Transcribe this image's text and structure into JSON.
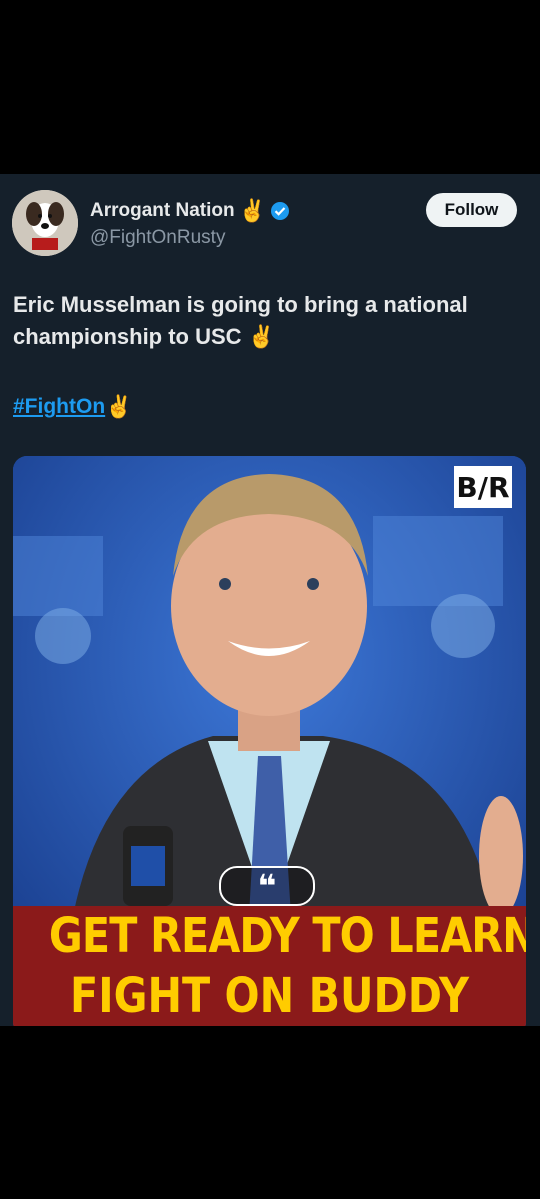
{
  "tweet": {
    "author_name": "Arrogant Nation",
    "author_emoji": "✌️",
    "handle": "@FightOnRusty",
    "follow_label": "Follow",
    "text": "Eric Musselman is going to bring a national championship to USC ✌️",
    "hashtag": "#FightOn",
    "hashtag_emoji": "✌️"
  },
  "media": {
    "logo_text": "B/R",
    "quote_mark": "❝",
    "headline_line1": "GET READY TO LEARN",
    "headline_line2": "FIGHT ON BUDDY"
  },
  "colors": {
    "background": "#000000",
    "card": "#15202b",
    "link": "#1d9bf0",
    "verified": "#1d9bf0",
    "headline_text": "#ffcc00",
    "headline_band": "#8b1a1a"
  }
}
